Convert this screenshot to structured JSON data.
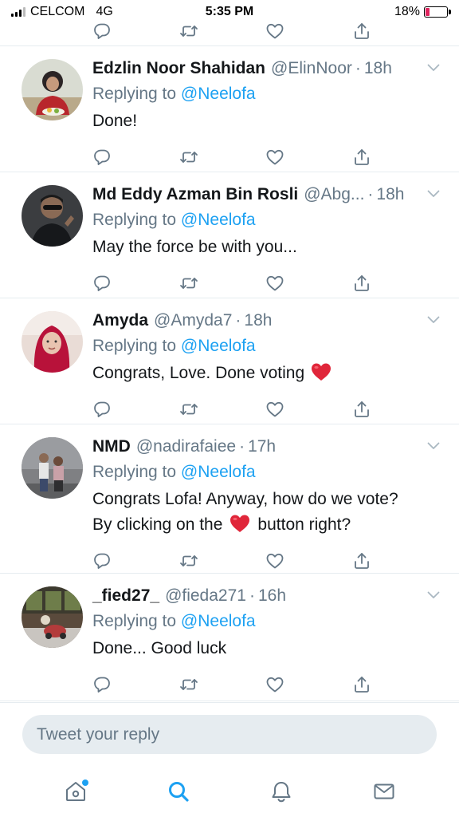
{
  "status_bar": {
    "carrier": "CELCOM",
    "network": "4G",
    "time": "5:35 PM",
    "battery_percent": "18%",
    "battery_level": 0.18
  },
  "colors": {
    "accent": "#1da1f2",
    "secondary_text": "#657786",
    "divider": "#e6ecf0",
    "battery_low": "#e0245e",
    "heart_emoji": "#e0263a"
  },
  "tweets": [
    {
      "name": "Edzlin Noor Shahidan",
      "handle": "@ElinNoor",
      "time": "18h",
      "replying_prefix": "Replying to",
      "replying_to": "@Neelofa",
      "text": "Done!"
    },
    {
      "name": "Md Eddy Azman Bin Rosli",
      "handle": "@Abg...",
      "time": "18h",
      "replying_prefix": "Replying to",
      "replying_to": "@Neelofa",
      "text": "May the force be with you..."
    },
    {
      "name": "Amyda",
      "handle": "@Amyda7",
      "time": "18h",
      "replying_prefix": "Replying to",
      "replying_to": "@Neelofa",
      "text": "Congrats, Love. Done voting"
    },
    {
      "name": "NMD",
      "handle": "@nadirafaiee",
      "time": "17h",
      "replying_prefix": "Replying to",
      "replying_to": "@Neelofa",
      "text_line1": "Congrats Lofa! Anyway, how do we vote?",
      "text_line2_before": "By clicking on the",
      "text_line2_after": "button right?"
    },
    {
      "name": "_fied27_",
      "handle": "@fieda271",
      "time": "16h",
      "replying_prefix": "Replying to",
      "replying_to": "@Neelofa",
      "text": "Done... Good luck"
    }
  ],
  "action_icons": [
    "reply-icon",
    "retweet-icon",
    "like-icon",
    "share-icon"
  ],
  "reply_bar": {
    "placeholder": "Tweet your reply"
  },
  "tab_bar": {
    "icons": [
      "home-icon",
      "search-icon",
      "notifications-icon",
      "messages-icon"
    ],
    "active": "search-icon"
  }
}
